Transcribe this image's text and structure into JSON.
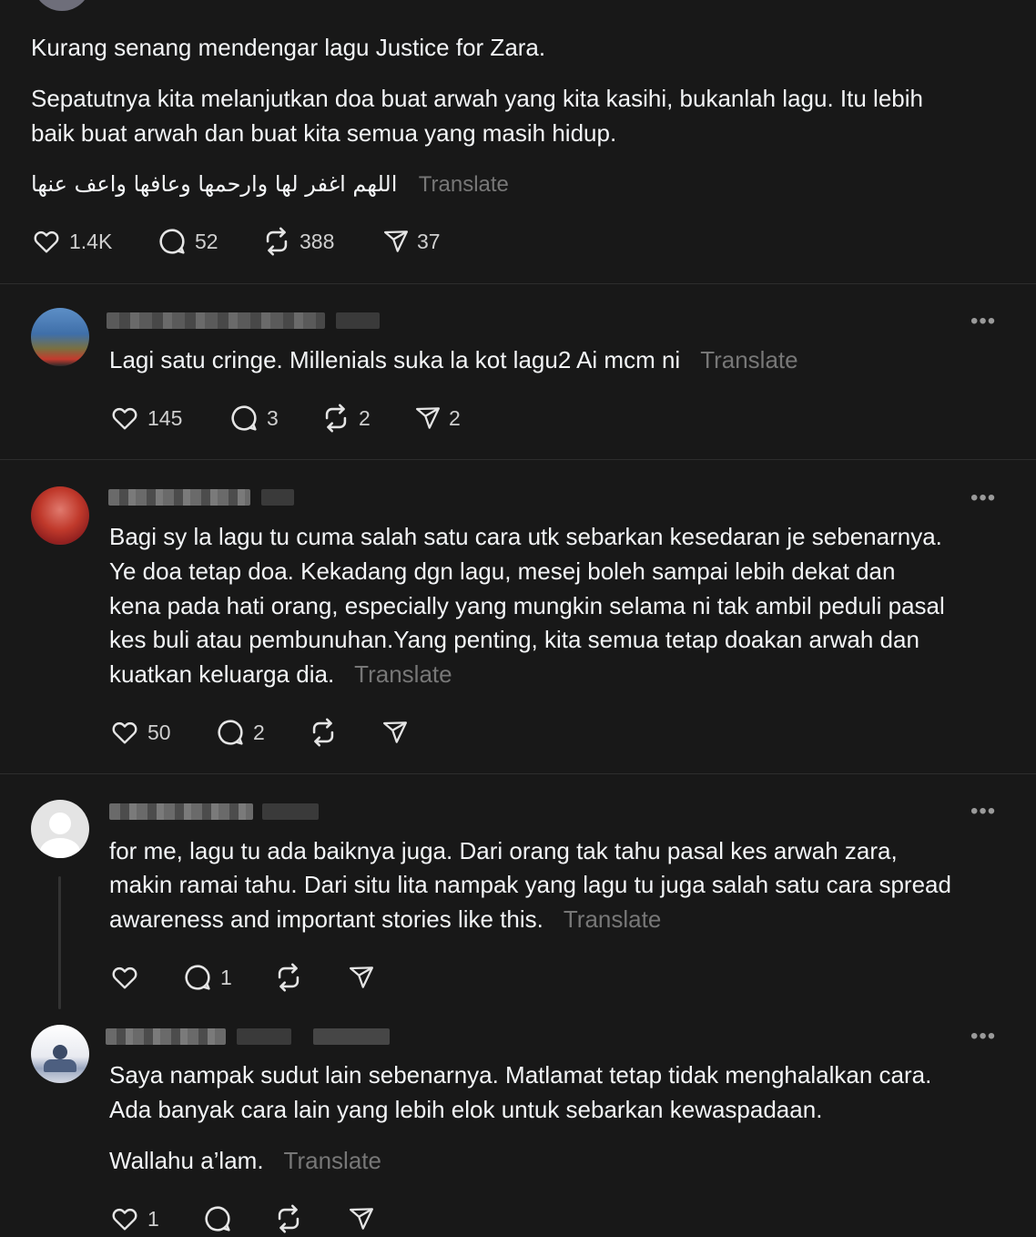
{
  "colors": {
    "background": "#181818",
    "text": "#f3f5f7",
    "muted": "#777777",
    "divider": "#2d2d2d"
  },
  "post": {
    "line1": "Kurang senang mendengar lagu Justice for Zara.",
    "para2_line1": "Sepatutnya kita melanjutkan doa buat arwah yang kita kasihi, bukanlah lagu. Itu lebih",
    "para2_line2": "baik buat arwah dan buat kita semua yang masih hidup.",
    "arabic": "اللهم اغفر لها وارحمها وعافها واعف عنها",
    "translate": "Translate",
    "likes": "1.4K",
    "replies": "52",
    "reposts": "388",
    "shares": "37"
  },
  "comments": [
    {
      "lines": [
        "Lagi satu cringe. Millenials suka la kot lagu2 Ai mcm ni"
      ],
      "translate": "Translate",
      "likes": "145",
      "replies": "3",
      "reposts": "2",
      "shares": "2"
    },
    {
      "lines": [
        "Bagi sy la lagu tu cuma salah satu cara utk sebarkan kesedaran je sebenarnya.",
        "Ye doa tetap doa. Kekadang dgn lagu, mesej boleh sampai lebih dekat dan",
        "kena pada hati orang, especially yang mungkin selama ni tak ambil peduli pasal",
        "kes buli atau pembunuhan.Yang penting, kita semua tetap doakan arwah dan",
        "kuatkan keluarga dia."
      ],
      "translate": "Translate",
      "likes": "50",
      "replies": "2",
      "reposts": "",
      "shares": ""
    },
    {
      "lines": [
        "for me, lagu tu ada baiknya juga. Dari orang tak tahu pasal kes arwah zara,",
        "makin ramai tahu. Dari situ lita nampak yang lagu tu juga salah satu cara spread",
        "awareness and important stories like this."
      ],
      "translate": "Translate",
      "likes": "",
      "replies": "1",
      "reposts": "",
      "shares": ""
    },
    {
      "lines": [
        "Saya nampak sudut lain sebenarnya. Matlamat tetap tidak menghalalkan cara.",
        "Ada banyak cara lain yang lebih elok untuk sebarkan kewaspadaan."
      ],
      "extra": "Wallahu a’lam.",
      "translate": "Translate",
      "likes": "1",
      "replies": "",
      "reposts": "",
      "shares": ""
    }
  ],
  "more_label": "•••",
  "icons": [
    "heart-icon",
    "reply-icon",
    "repost-icon",
    "share-icon",
    "more-icon"
  ]
}
